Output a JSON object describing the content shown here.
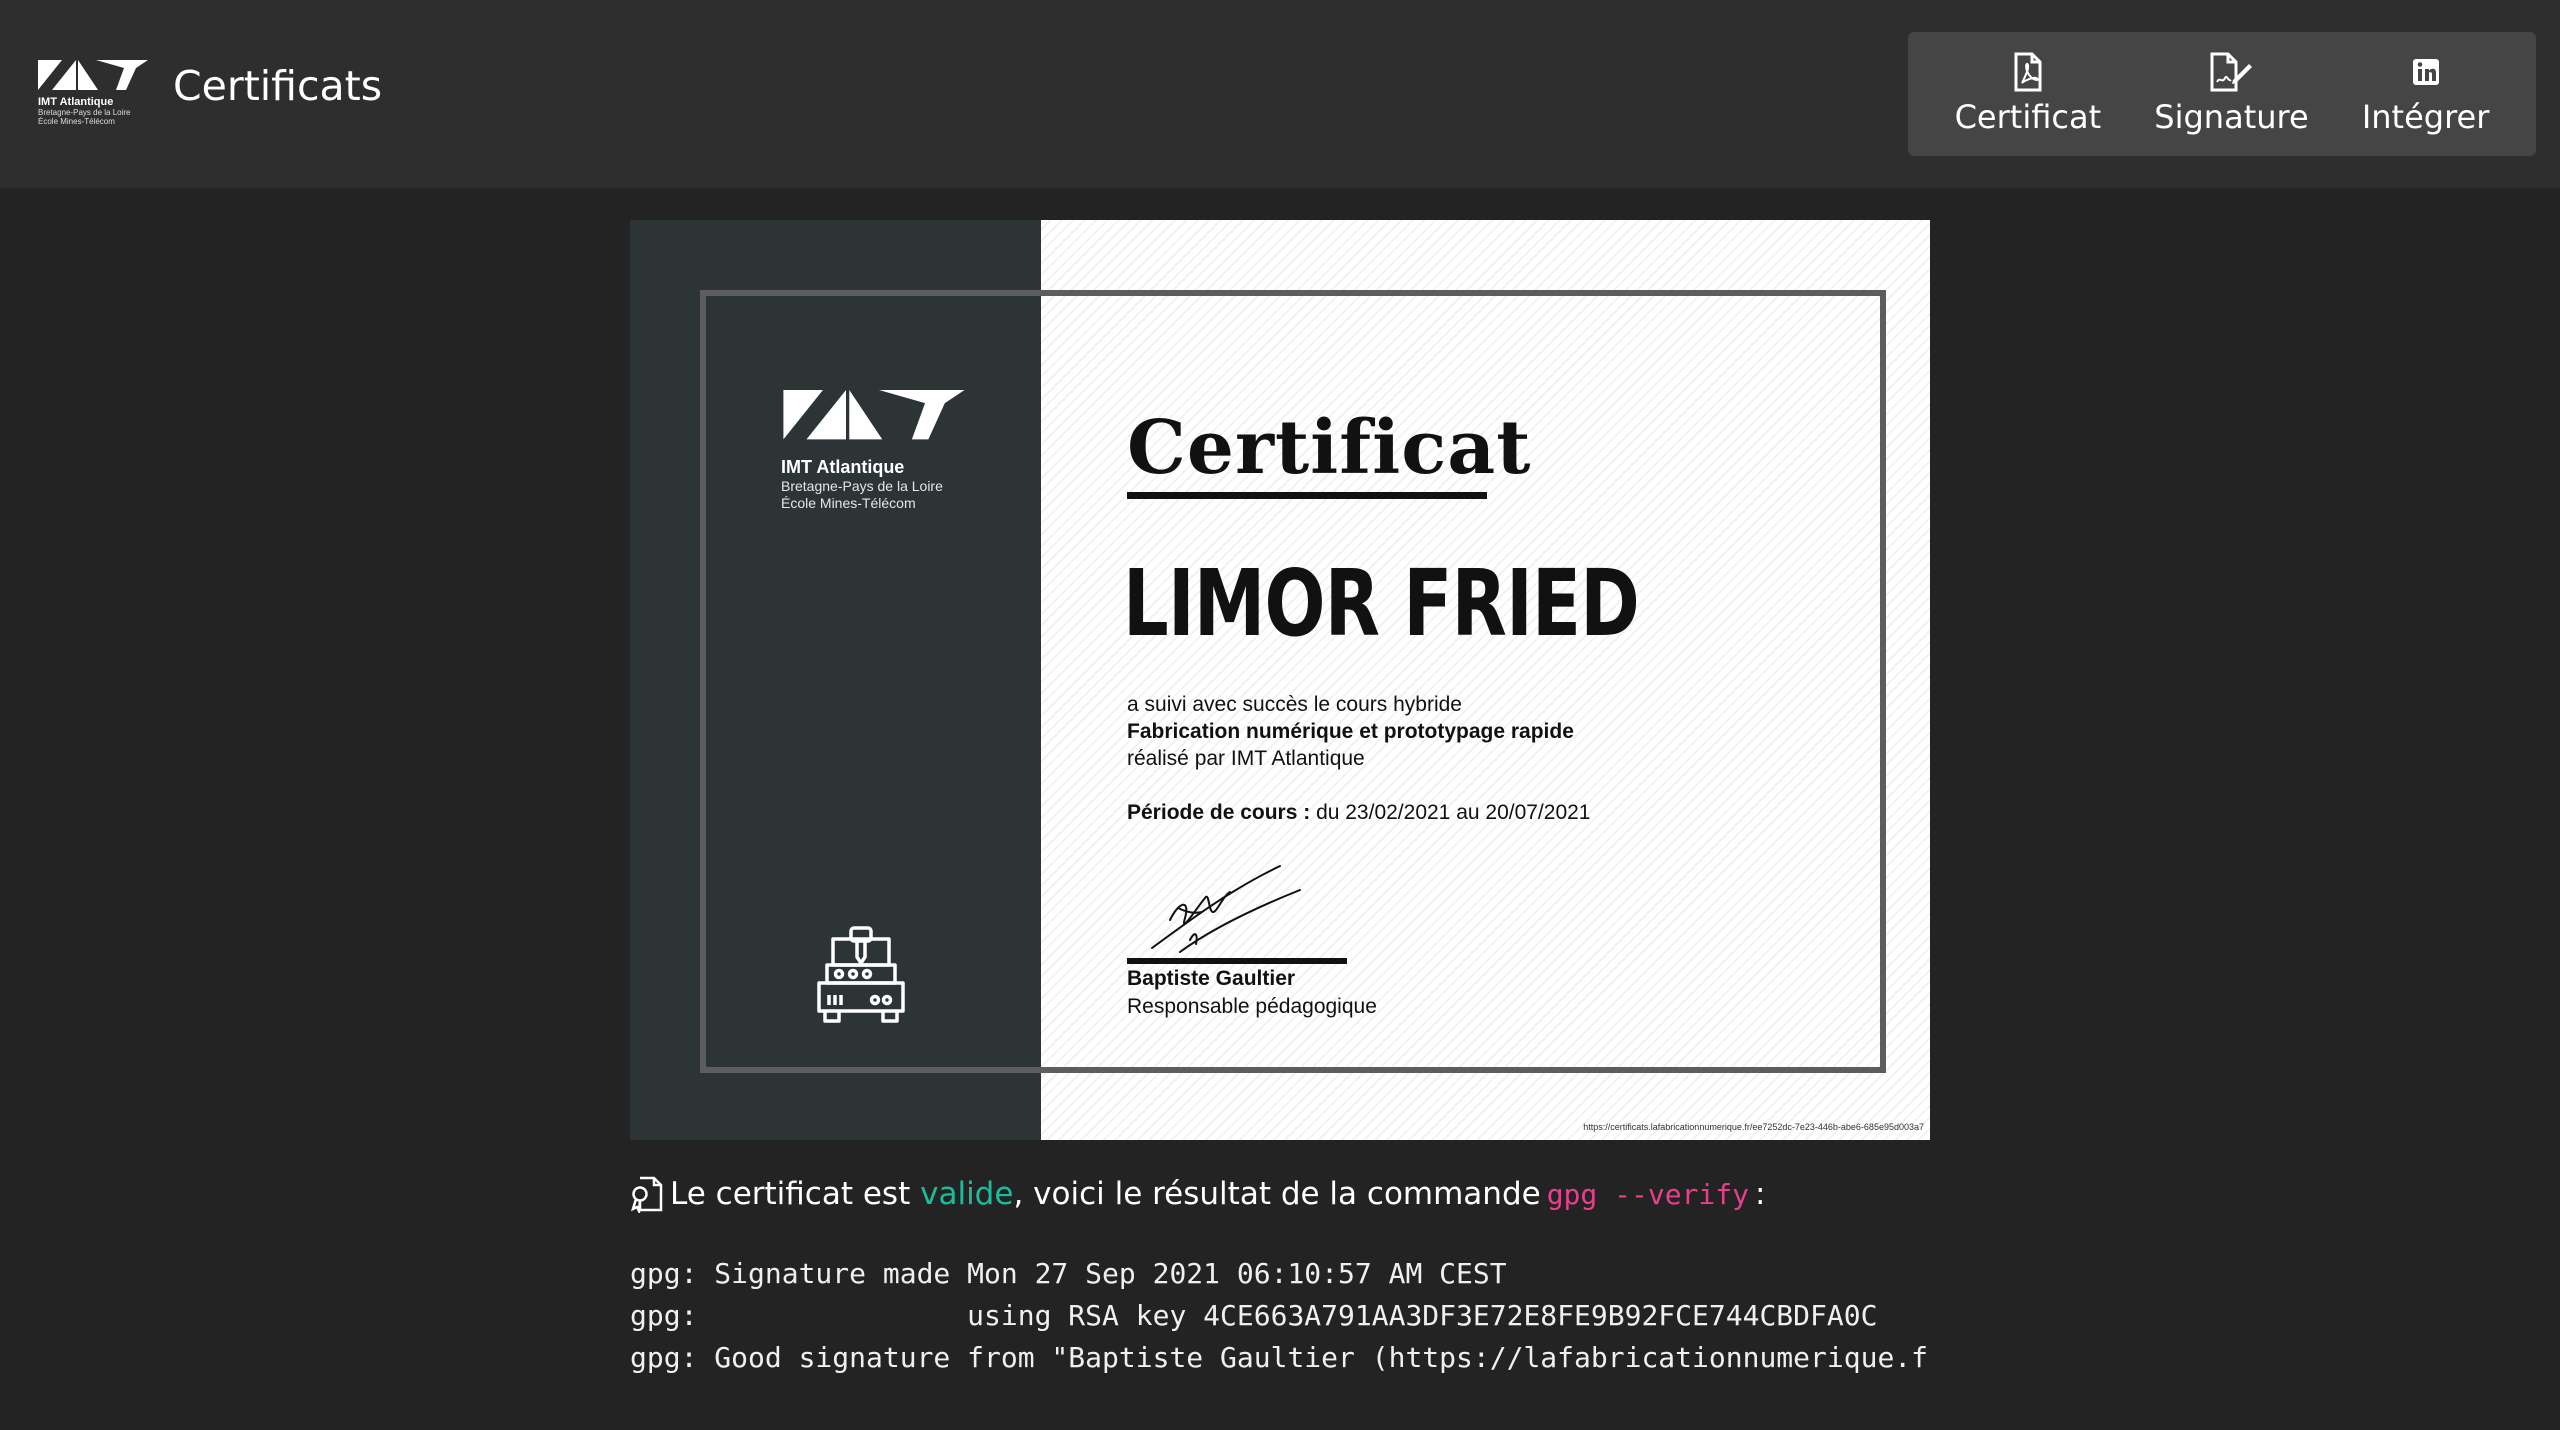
{
  "header": {
    "logo": {
      "line1": "IMT Atlantique",
      "line2": "Bretagne-Pays de la Loire",
      "line3": "École Mines-Télécom"
    },
    "title": "Certificats",
    "nav": [
      {
        "label": "Certificat",
        "icon": "pdf-file-icon"
      },
      {
        "label": "Signature",
        "icon": "signature-file-icon"
      },
      {
        "label": "Intégrer",
        "icon": "linkedin-icon"
      }
    ]
  },
  "certificate": {
    "logo": {
      "name": "IMT Atlantique",
      "line2": "Bretagne-Pays de la Loire",
      "line3": "École Mines-Télécom"
    },
    "heading": "Certificat",
    "recipient": "LIMOR FRIED",
    "line1": "a suivi avec succès le cours hybride",
    "course": "Fabrication numérique et prototypage rapide",
    "line3": "réalisé par IMT Atlantique",
    "period_label": "Période de cours :",
    "period_value": "du 23/02/2021 au 20/07/2021",
    "signer": "Baptiste Gaultier",
    "signer_role": "Responsable pédagogique",
    "url": "https://certificats.lafabricationnumerique.fr/ee7252dc-7e23-446b-abe6-685e95d003a7"
  },
  "verification": {
    "prefix": "Le certificat est",
    "status": "valide",
    "middle": ", voici le résultat de la commande",
    "command": "gpg --verify",
    "suffix": ":",
    "output": [
      "gpg: Signature made Mon 27 Sep 2021 06:10:57 AM CEST",
      "gpg:                using RSA key 4CE663A791AA3DF3E72E8FE9B92FCE744CBDFA0C",
      "gpg: Good signature from \"Baptiste Gaultier (https://lafabricationnumerique.f"
    ]
  },
  "colors": {
    "valid": "#1abc9c",
    "command": "#e83e8c",
    "header_bg": "#2e2e2e",
    "page_bg": "#232323"
  }
}
